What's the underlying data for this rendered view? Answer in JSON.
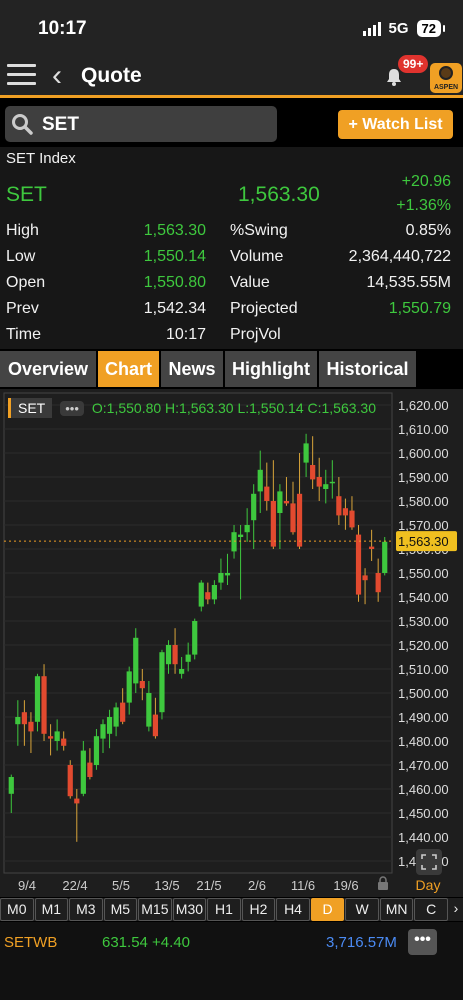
{
  "status_bar": {
    "time": "10:17",
    "network": "5G",
    "battery": "72"
  },
  "header": {
    "title": "Quote",
    "notification_badge": "99+",
    "logo_text": "ASPEN"
  },
  "search": {
    "value": "SET",
    "watch_list_label": "+ Watch List"
  },
  "quote": {
    "index_name": "SET Index",
    "symbol": "SET",
    "last": "1,563.30",
    "change": "+20.96",
    "change_pct": "+1.36%",
    "left_labels": [
      "High",
      "Low",
      "Open",
      "Prev",
      "Time"
    ],
    "left_values": [
      "1,563.30",
      "1,550.14",
      "1,550.80",
      "1,542.34",
      "10:17"
    ],
    "right_labels": [
      "%Swing",
      "Volume",
      "Value",
      "Projected",
      "ProjVol"
    ],
    "right_values": [
      "0.85%",
      "2,364,440,722",
      "14,535.55M",
      "1,550.79",
      ""
    ]
  },
  "tabs": [
    "Overview",
    "Chart",
    "News",
    "Highlight",
    "Historical"
  ],
  "chart_header": {
    "symbol": "SET",
    "more": "•••",
    "ohlc": "O:1,550.80 H:1,563.30 L:1,550.14 C:1,563.30"
  },
  "chart_data": {
    "type": "candlestick",
    "last_price_label": "1,563.30",
    "period_label": "Day",
    "y_ticks": [
      "1,620.00",
      "1,610.00",
      "1,600.00",
      "1,590.00",
      "1,580.00",
      "1,570.00",
      "1,560.00",
      "1,550.00",
      "1,540.00",
      "1,530.00",
      "1,520.00",
      "1,510.00",
      "1,500.00",
      "1,490.00",
      "1,480.00",
      "1,470.00",
      "1,460.00",
      "1,450.00",
      "1,440.00",
      "1,430.00"
    ],
    "x_labels": [
      "9/4",
      "22/4",
      "5/5",
      "13/5",
      "21/5",
      "2/6",
      "11/6",
      "19/6"
    ],
    "ylim": [
      1425,
      1625
    ],
    "candles": [
      {
        "o": 1458,
        "h": 1466,
        "l": 1450,
        "c": 1465
      },
      {
        "o": 1487,
        "h": 1497,
        "l": 1478,
        "c": 1490
      },
      {
        "o": 1492,
        "h": 1497,
        "l": 1478,
        "c": 1487
      },
      {
        "o": 1488,
        "h": 1492,
        "l": 1475,
        "c": 1484
      },
      {
        "o": 1488,
        "h": 1508,
        "l": 1484,
        "c": 1507
      },
      {
        "o": 1507,
        "h": 1512,
        "l": 1480,
        "c": 1483
      },
      {
        "o": 1482,
        "h": 1487,
        "l": 1474,
        "c": 1481
      },
      {
        "o": 1480,
        "h": 1489,
        "l": 1476,
        "c": 1484
      },
      {
        "o": 1481,
        "h": 1484,
        "l": 1476,
        "c": 1478
      },
      {
        "o": 1470,
        "h": 1472,
        "l": 1456,
        "c": 1457
      },
      {
        "o": 1456,
        "h": 1460,
        "l": 1438,
        "c": 1454
      },
      {
        "o": 1458,
        "h": 1480,
        "l": 1457,
        "c": 1476
      },
      {
        "o": 1471,
        "h": 1477,
        "l": 1464,
        "c": 1465
      },
      {
        "o": 1470,
        "h": 1485,
        "l": 1468,
        "c": 1482
      },
      {
        "o": 1481,
        "h": 1489,
        "l": 1475,
        "c": 1487
      },
      {
        "o": 1483,
        "h": 1493,
        "l": 1477,
        "c": 1490
      },
      {
        "o": 1486,
        "h": 1496,
        "l": 1482,
        "c": 1494
      },
      {
        "o": 1496,
        "h": 1502,
        "l": 1487,
        "c": 1488
      },
      {
        "o": 1496,
        "h": 1511,
        "l": 1491,
        "c": 1509
      },
      {
        "o": 1504,
        "h": 1527,
        "l": 1500,
        "c": 1523
      },
      {
        "o": 1505,
        "h": 1510,
        "l": 1497,
        "c": 1502
      },
      {
        "o": 1486,
        "h": 1505,
        "l": 1484,
        "c": 1500
      },
      {
        "o": 1491,
        "h": 1498,
        "l": 1481,
        "c": 1482
      },
      {
        "o": 1492,
        "h": 1518,
        "l": 1489,
        "c": 1517
      },
      {
        "o": 1512,
        "h": 1522,
        "l": 1508,
        "c": 1520
      },
      {
        "o": 1520,
        "h": 1527,
        "l": 1508,
        "c": 1512
      },
      {
        "o": 1508,
        "h": 1515,
        "l": 1506,
        "c": 1510
      },
      {
        "o": 1513,
        "h": 1521,
        "l": 1509,
        "c": 1516
      },
      {
        "o": 1516,
        "h": 1531,
        "l": 1514,
        "c": 1530
      },
      {
        "o": 1536,
        "h": 1547,
        "l": 1534,
        "c": 1546
      },
      {
        "o": 1542,
        "h": 1546,
        "l": 1537,
        "c": 1539
      },
      {
        "o": 1539,
        "h": 1547,
        "l": 1537,
        "c": 1545
      },
      {
        "o": 1546,
        "h": 1556,
        "l": 1543,
        "c": 1550
      },
      {
        "o": 1549,
        "h": 1558,
        "l": 1545,
        "c": 1550
      },
      {
        "o": 1559,
        "h": 1570,
        "l": 1556,
        "c": 1567
      },
      {
        "o": 1565,
        "h": 1570,
        "l": 1539,
        "c": 1566
      },
      {
        "o": 1567,
        "h": 1577,
        "l": 1563,
        "c": 1570
      },
      {
        "o": 1572,
        "h": 1587,
        "l": 1560,
        "c": 1583
      },
      {
        "o": 1584,
        "h": 1601,
        "l": 1575,
        "c": 1593
      },
      {
        "o": 1586,
        "h": 1596,
        "l": 1576,
        "c": 1580
      },
      {
        "o": 1580,
        "h": 1597,
        "l": 1560,
        "c": 1561
      },
      {
        "o": 1575,
        "h": 1587,
        "l": 1560,
        "c": 1584
      },
      {
        "o": 1580,
        "h": 1590,
        "l": 1578,
        "c": 1579
      },
      {
        "o": 1579,
        "h": 1588,
        "l": 1566,
        "c": 1567
      },
      {
        "o": 1583,
        "h": 1600,
        "l": 1560,
        "c": 1561
      },
      {
        "o": 1596,
        "h": 1608,
        "l": 1590,
        "c": 1604
      },
      {
        "o": 1595,
        "h": 1607,
        "l": 1585,
        "c": 1589
      },
      {
        "o": 1590,
        "h": 1598,
        "l": 1580,
        "c": 1586
      },
      {
        "o": 1585,
        "h": 1593,
        "l": 1579,
        "c": 1587
      },
      {
        "o": 1588,
        "h": 1597,
        "l": 1581,
        "c": 1588
      },
      {
        "o": 1582,
        "h": 1590,
        "l": 1570,
        "c": 1574
      },
      {
        "o": 1577,
        "h": 1581,
        "l": 1568,
        "c": 1574
      },
      {
        "o": 1576,
        "h": 1582,
        "l": 1568,
        "c": 1569
      },
      {
        "o": 1566,
        "h": 1570,
        "l": 1538,
        "c": 1541
      },
      {
        "o": 1549,
        "h": 1552,
        "l": 1537,
        "c": 1547
      },
      {
        "o": 1561,
        "h": 1568,
        "l": 1555,
        "c": 1560
      },
      {
        "o": 1550,
        "h": 1556,
        "l": 1538,
        "c": 1542
      },
      {
        "o": 1550,
        "h": 1565,
        "l": 1549,
        "c": 1563
      }
    ]
  },
  "timeframes": [
    "M0",
    "M1",
    "M3",
    "M5",
    "M15",
    "M30",
    "H1",
    "H2",
    "H4",
    "D",
    "W",
    "MN",
    "C"
  ],
  "active_timeframe": "D",
  "bottom_bar": {
    "symbol": "SETWB",
    "price_change": "631.54 +4.40",
    "volume": "3,716.57M",
    "more": "•••"
  },
  "colors": {
    "accent": "#f0a024",
    "up": "#3ec83e",
    "down": "#e24a2f",
    "volume": "#4b8bf4"
  },
  "icons": [
    "menu-icon",
    "back-icon",
    "bell-icon",
    "search-icon",
    "lock-icon",
    "expand-icon",
    "scroll-right-icon"
  ]
}
